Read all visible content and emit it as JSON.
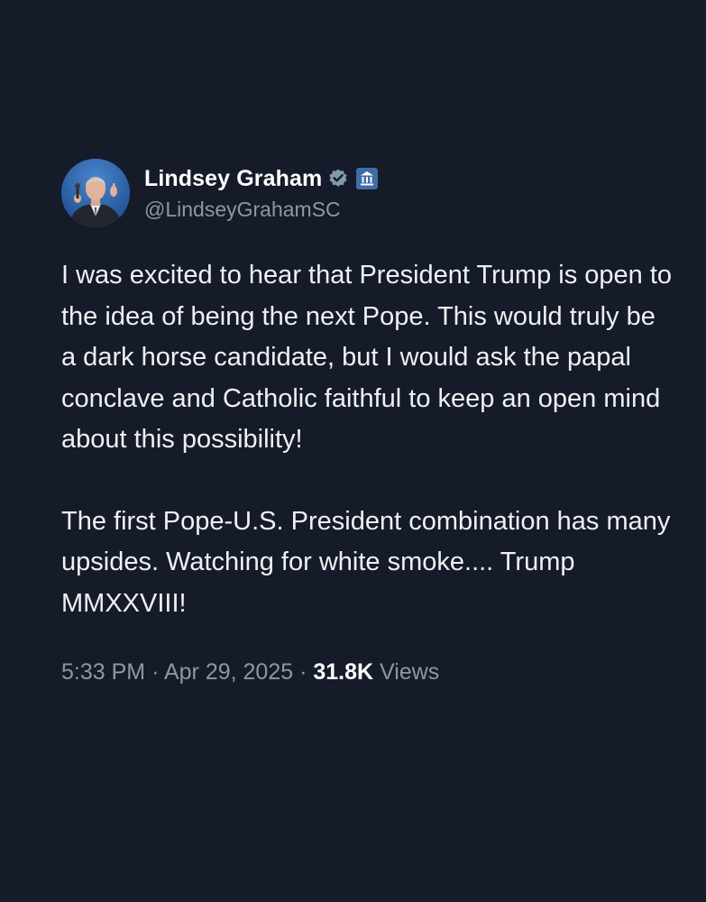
{
  "author": {
    "display_name": "Lindsey Graham",
    "handle": "@LindseyGrahamSC",
    "verified_icon": "verified-badge-icon",
    "affiliation_icon": "government-building-icon",
    "colors": {
      "verified_badge": "#829aab",
      "gov_badge": "#3e6ea5"
    }
  },
  "tweet": {
    "paragraphs": [
      "I was excited to hear that President Trump is open to the idea of being the next Pope. This would truly be a dark horse candidate, but I would ask the papal conclave and Catholic faithful to keep an open mind about this possibility!",
      "The first Pope-U.S. President combination has many upsides. Watching for white smoke.... Trump MMXXVIII!"
    ]
  },
  "meta": {
    "time": "5:33 PM",
    "separator": "·",
    "date": "Apr 29, 2025",
    "views_count": "31.8K",
    "views_label": "Views"
  },
  "colors": {
    "background": "#151b29",
    "text": "#eef0f2",
    "secondary_text": "#8b98a5"
  }
}
